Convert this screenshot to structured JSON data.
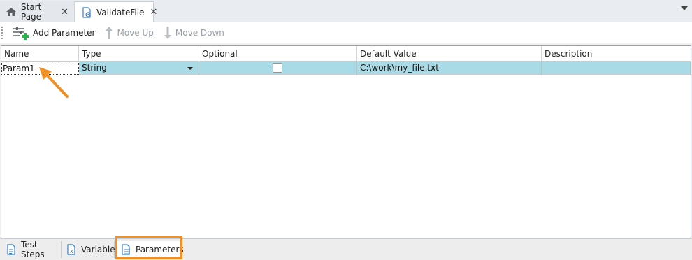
{
  "tabs": [
    {
      "label": "Start Page",
      "icon": "home-icon"
    },
    {
      "label": "ValidateFile",
      "icon": "script-file-icon"
    }
  ],
  "toolbar": {
    "add_label": "Add Parameter",
    "move_up_label": "Move Up",
    "move_down_label": "Move Down"
  },
  "grid": {
    "columns": [
      "Name",
      "Type",
      "Optional",
      "Default Value",
      "Description"
    ],
    "rows": [
      {
        "name": "Param1",
        "type": "String",
        "optional": false,
        "default_value": "C:\\work\\my_file.txt",
        "description": ""
      }
    ]
  },
  "bottom_tabs": [
    {
      "label": "Test Steps",
      "icon": "test-steps-icon"
    },
    {
      "label": "Variables",
      "icon": "variables-icon"
    },
    {
      "label": "Parameters",
      "icon": "parameters-icon"
    }
  ],
  "colors": {
    "selected_row": "#a9dbe6",
    "annotation": "#f29024",
    "add_icon_green": "#2bb24c"
  }
}
